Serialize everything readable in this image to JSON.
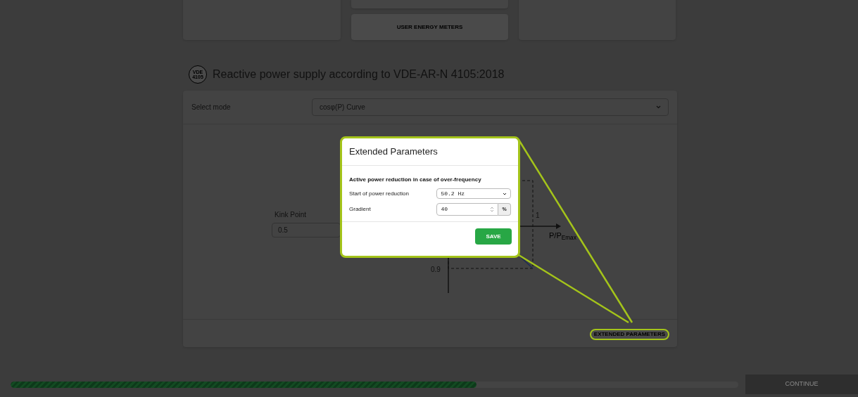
{
  "top_buttons": [
    {
      "label": "USER ENERGY METERS"
    }
  ],
  "section": {
    "title": "Reactive power supply according to VDE-AR-N 4105:2018",
    "icon_text": "VDE 4105"
  },
  "mode": {
    "label": "Select mode",
    "value": "cosφ(P) Curve"
  },
  "kink_point": {
    "label": "Kink Point",
    "value": "0.5"
  },
  "chart": {
    "x_label": "P/P$_{Emax}$",
    "x_tick": "1",
    "y_tick": "0.9"
  },
  "extended_button": {
    "label": "EXTENDED PARAMETERS",
    "highlighted": true
  },
  "dialog": {
    "title": "Extended Parameters",
    "subtitle": "Active power reduction in case of over-frequency",
    "fields": [
      {
        "kind": "select",
        "label": "Start of power reduction",
        "value": "50.2 Hz"
      },
      {
        "kind": "number",
        "label": "Gradient",
        "value": "40",
        "unit": "%"
      }
    ],
    "save": "SAVE"
  },
  "progress": {
    "level": 0.64
  },
  "continue": {
    "label": "CONTINUE",
    "disabled": true
  }
}
